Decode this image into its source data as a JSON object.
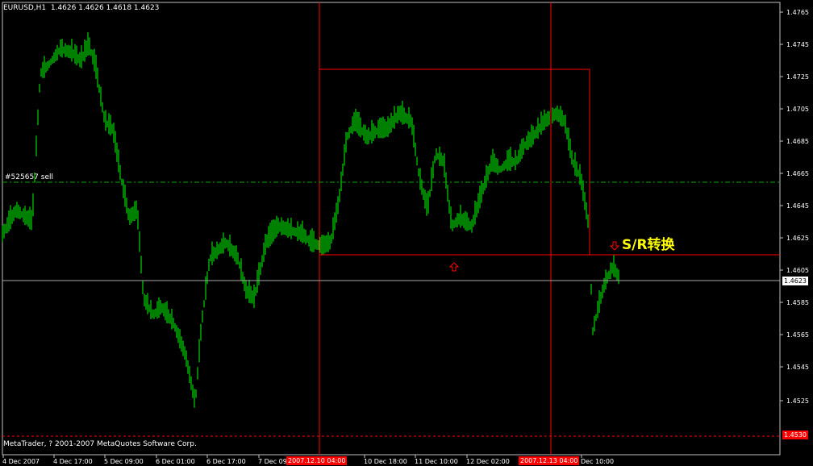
{
  "header": {
    "symbol": "EURUSD,H1",
    "ohlc": "1.4626 1.4626 1.4618 1.4623"
  },
  "copyright": "MetaTrader, ? 2001-2007 MetaQuotes Software Corp.",
  "order_label": "#525657  sell",
  "annotation": "S/R转换",
  "price_axis": {
    "labels": [
      "1.4765",
      "1.4745",
      "1.4725",
      "1.4705",
      "1.4685",
      "1.4665",
      "1.4645",
      "1.4625",
      "1.4605",
      "1.4585",
      "1.4565",
      "1.4545",
      "1.4525"
    ],
    "current_price": "1.4623",
    "low_line_price": "1.4530"
  },
  "time_axis": {
    "labels": [
      "4 Dec 2007",
      "4 Dec 17:00",
      "5 Dec 09:00",
      "6 Dec 01:00",
      "6 Dec 17:00",
      "7 Dec 09:00",
      "10 Dec 18:00",
      "11 Dec 10:00",
      "12 Dec 02:00",
      "Dec 10:00"
    ],
    "vline1_date": "2007.12.10 04:00",
    "vline2_date": "2007.12.13 04:00"
  },
  "colors": {
    "background": "#000000",
    "candles": "#00ff00",
    "grid_lines": "#ff0000",
    "order_line": "#00aa00",
    "annotation": "#ffff00"
  }
}
